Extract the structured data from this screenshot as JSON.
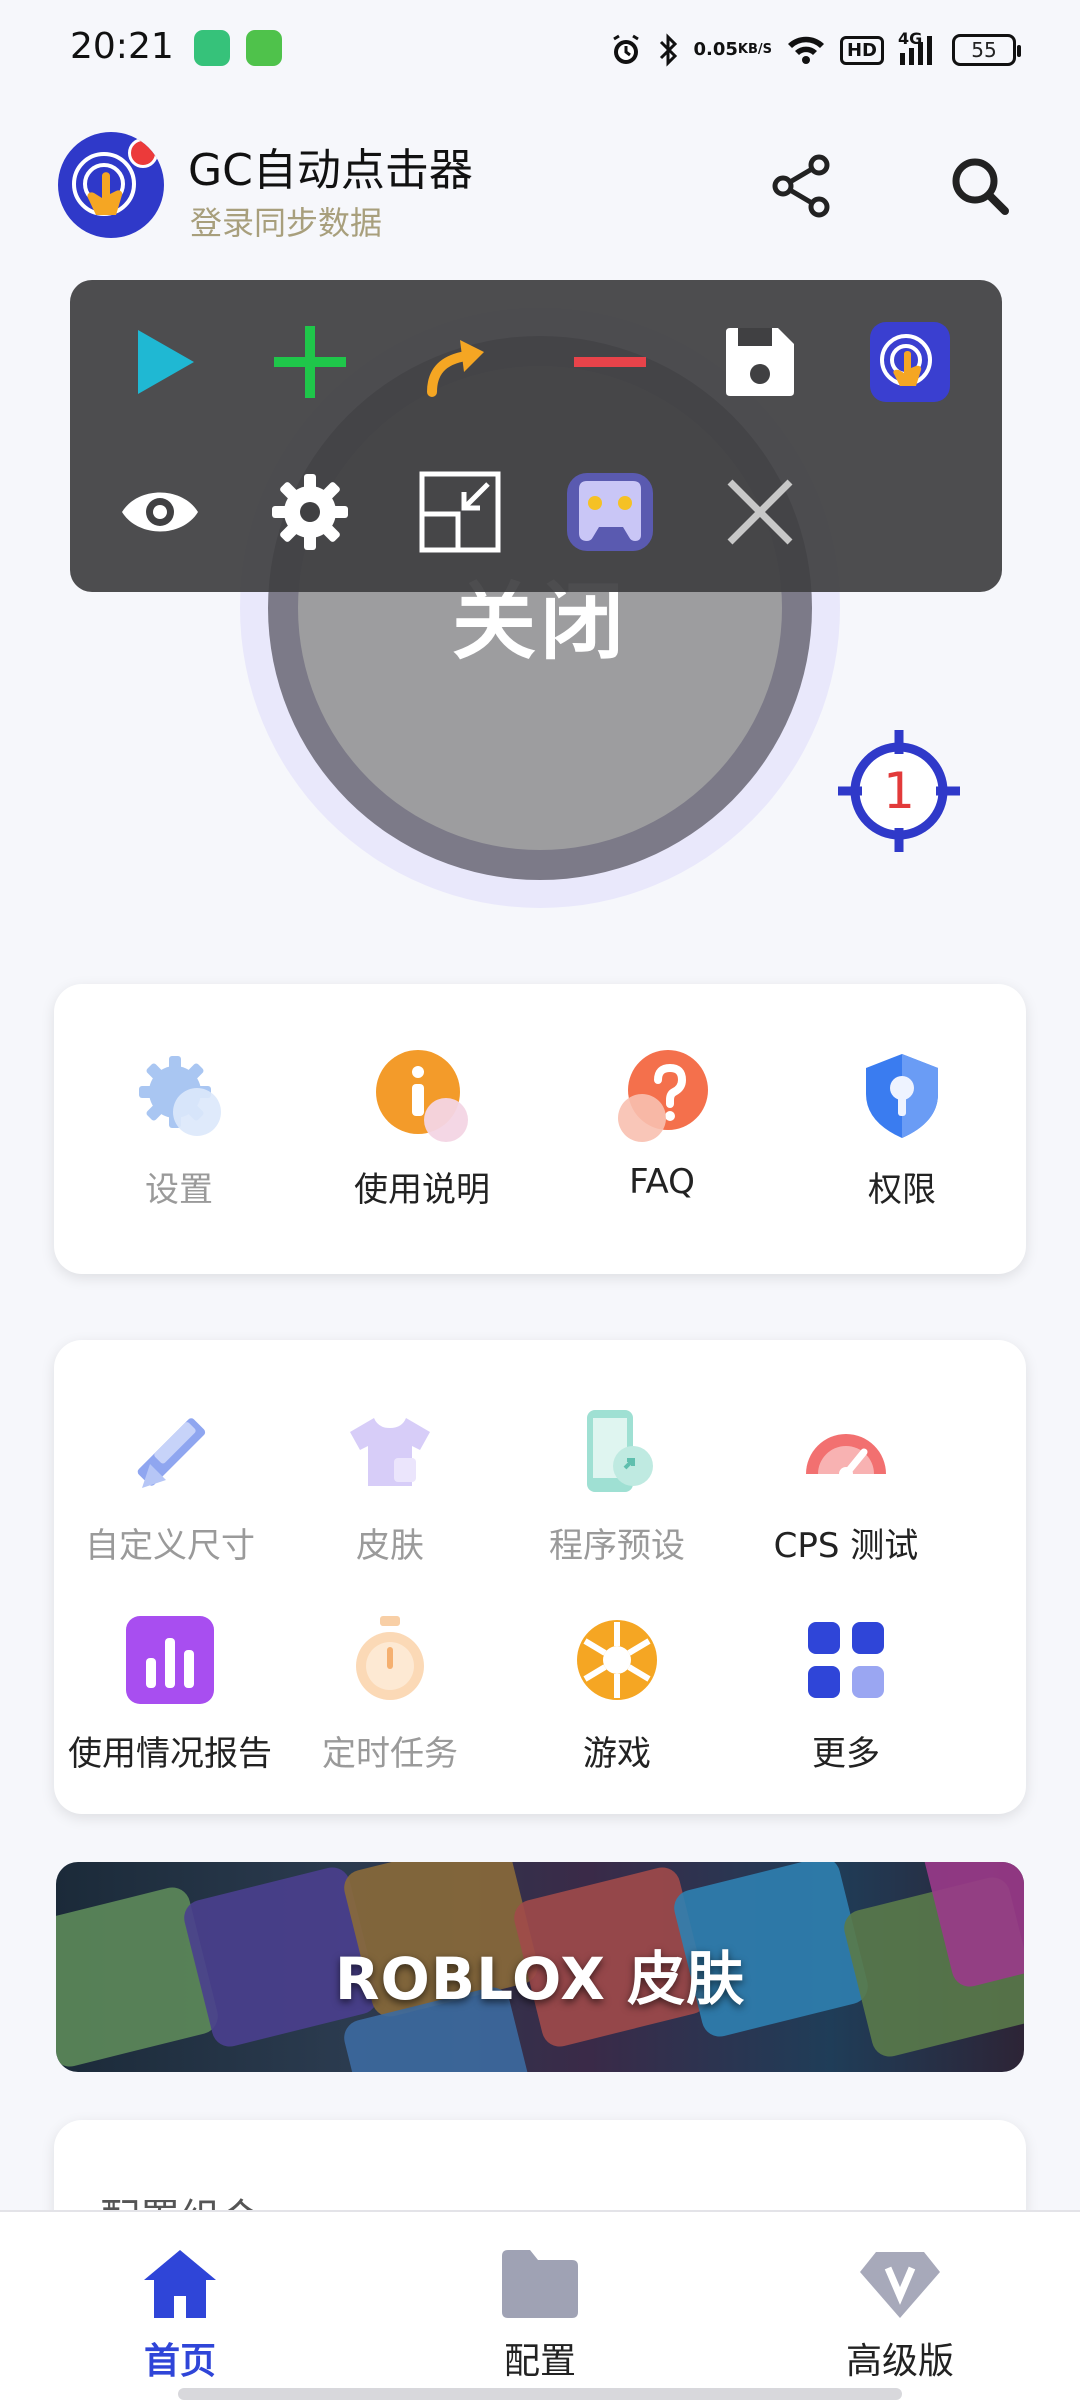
{
  "status_bar": {
    "time": "20:21",
    "net_speed_value": "0.05",
    "net_speed_unit": "KB/S",
    "hd_label": "HD",
    "signal_label": "4G",
    "battery": "55"
  },
  "header": {
    "title": "GC自动点击器",
    "subtitle": "登录同步数据"
  },
  "main_button": {
    "label": "关闭"
  },
  "target": {
    "number": "1"
  },
  "quick_actions": [
    {
      "label": "设置",
      "icon": "gear-icon",
      "dim": true
    },
    {
      "label": "使用说明",
      "icon": "info-icon",
      "dim": false
    },
    {
      "label": "FAQ",
      "icon": "question-icon",
      "dim": false
    },
    {
      "label": "权限",
      "icon": "shield-key-icon",
      "dim": false
    }
  ],
  "tools": [
    {
      "label": "自定义尺寸",
      "icon": "ruler-pencil-icon",
      "dim": true
    },
    {
      "label": "皮肤",
      "icon": "tshirt-icon",
      "dim": true
    },
    {
      "label": "程序预设",
      "icon": "phone-link-icon",
      "dim": true
    },
    {
      "label": "CPS 测试",
      "icon": "speedometer-icon",
      "dim": false
    },
    {
      "label": "使用情况报告",
      "icon": "bar-chart-icon",
      "dim": false
    },
    {
      "label": "定时任务",
      "icon": "stopwatch-icon",
      "dim": true
    },
    {
      "label": "游戏",
      "icon": "aperture-icon",
      "dim": false
    },
    {
      "label": "更多",
      "icon": "grid-icon",
      "dim": false
    }
  ],
  "banner": {
    "title": "ROBLOX 皮肤"
  },
  "config_section": {
    "title": "配置组合"
  },
  "bottom_nav": [
    {
      "label": "首页",
      "icon": "home-icon",
      "active": true
    },
    {
      "label": "配置",
      "icon": "folder-icon",
      "active": false
    },
    {
      "label": "高级版",
      "icon": "diamond-v-icon",
      "active": false
    }
  ],
  "colors": {
    "accent": "#2f45d8",
    "toolbar_bg": "#404042",
    "play": "#1fb8d3",
    "add": "#1fc64a",
    "swipe": "#f5a623",
    "remove": "#e8434a"
  }
}
